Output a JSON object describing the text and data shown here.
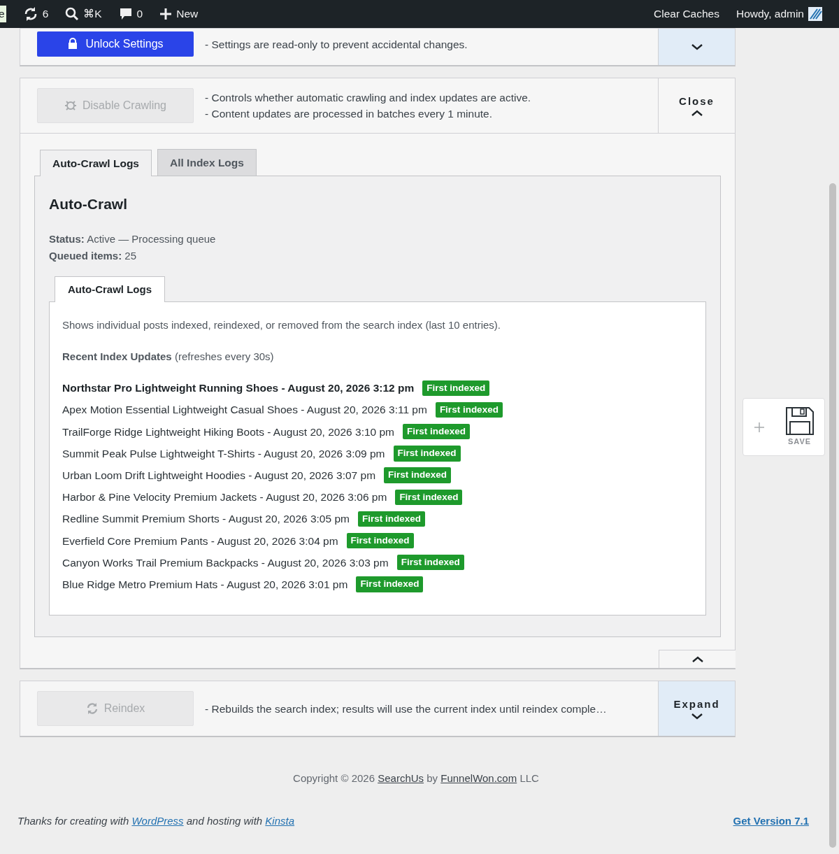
{
  "admin_bar": {
    "site_fragment": "e",
    "updates": "6",
    "search_shortcut": "⌘K",
    "comments": "0",
    "new": "New",
    "clear_caches": "Clear Caches",
    "greeting": "Howdy, admin"
  },
  "panels": [
    {
      "button": "Unlock Settings",
      "kind": "lock",
      "disabled": false,
      "lines": [
        "- Settings are read-only to prevent accidental changes."
      ],
      "expanded": false
    },
    {
      "button": "Disable Crawling",
      "kind": "bug",
      "disabled": true,
      "lines": [
        "- Controls whether automatic crawling and index updates are active.",
        "- Content updates are processed in batches every 1 minute."
      ],
      "expanded": true,
      "toggle": "Close"
    },
    {
      "button": "Reindex",
      "kind": "sync",
      "disabled": true,
      "lines": [
        "- Rebuilds the search index; results will use the current index until reindex comple…"
      ],
      "expanded": false,
      "toggle": "Expand"
    }
  ],
  "tabs": [
    {
      "label": "Auto-Crawl Logs",
      "selected": true
    },
    {
      "label": "All Index Logs",
      "selected": false
    }
  ],
  "section": {
    "title": "Auto-Crawl",
    "status_label": "Status:",
    "status": "Active — Processing queue",
    "queued_label": "Queued items:",
    "queued": "25"
  },
  "subtabs": [
    {
      "label": "Auto-Crawl Logs",
      "selected": true
    }
  ],
  "log": {
    "description": "Shows individual posts indexed, reindexed, or removed from the search index (last 10 entries).",
    "heading": "Recent Index Updates",
    "refresh_note": "(refreshes every 30s)",
    "entries": [
      {
        "text": "Northstar Pro Lightweight Running Shoes - August 20, 2026 3:12 pm",
        "badge": "First indexed",
        "latest": true
      },
      {
        "text": "Apex Motion Essential Lightweight Casual Shoes - August 20, 2026 3:11 pm",
        "badge": "First indexed",
        "latest": false
      },
      {
        "text": "TrailForge Ridge Lightweight Hiking Boots - August 20, 2026 3:10 pm",
        "badge": "First indexed",
        "latest": false
      },
      {
        "text": "Summit Peak Pulse Lightweight T-Shirts - August 20, 2026 3:09 pm",
        "badge": "First indexed",
        "latest": false
      },
      {
        "text": "Urban Loom Drift Lightweight Hoodies - August 20, 2026 3:07 pm",
        "badge": "First indexed",
        "latest": false
      },
      {
        "text": "Harbor & Pine Velocity Premium Jackets - August 20, 2026 3:06 pm",
        "badge": "First indexed",
        "latest": false
      },
      {
        "text": "Redline Summit Premium Shorts - August 20, 2026 3:05 pm",
        "badge": "First indexed",
        "latest": false
      },
      {
        "text": "Everfield Core Premium Pants - August 20, 2026 3:04 pm",
        "badge": "First indexed",
        "latest": false
      },
      {
        "text": "Canyon Works Trail Premium Backpacks - August 20, 2026 3:03 pm",
        "badge": "First indexed",
        "latest": false
      },
      {
        "text": "Blue Ridge Metro Premium Hats - August 20, 2026 3:01 pm",
        "badge": "First indexed",
        "latest": false
      }
    ]
  },
  "save_widget": {
    "label": "SAVE"
  },
  "copyright": [
    {
      "kind": "text",
      "text": "Copyright © 2026 "
    },
    {
      "kind": "link",
      "text": "SearchUs"
    },
    {
      "kind": "text",
      "text": " by "
    },
    {
      "kind": "link",
      "text": "FunnelWon.com"
    },
    {
      "kind": "text",
      "text": " LLC"
    }
  ],
  "footer": {
    "thanks": [
      {
        "kind": "text",
        "text": "Thanks for creating with "
      },
      {
        "kind": "link",
        "text": "WordPress"
      },
      {
        "kind": "text",
        "text": " and hosting with "
      },
      {
        "kind": "link",
        "text": "Kinsta"
      }
    ],
    "version": "Get Version 7.1"
  }
}
